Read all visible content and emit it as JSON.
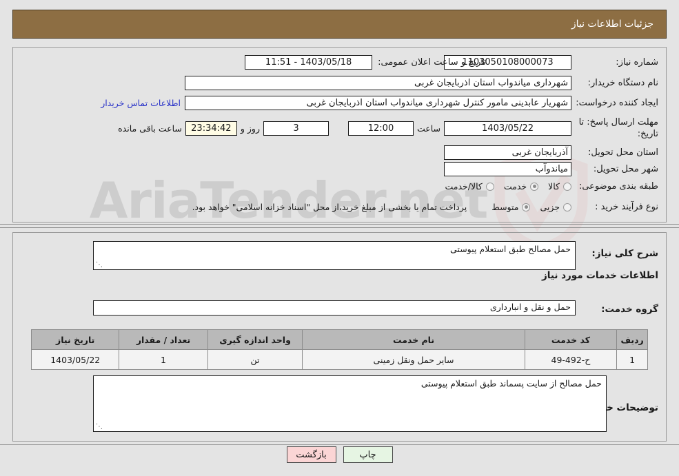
{
  "header": {
    "title": "جزئیات اطلاعات نیاز"
  },
  "watermark": {
    "text": "AriaTender.net",
    "logo": "shield-logo"
  },
  "form": {
    "need_number": {
      "label": "شماره نیاز:",
      "value": "1103050108000073"
    },
    "announce_datetime": {
      "label": "تاریخ و ساعت اعلان عمومی:",
      "value": "1403/05/18 - 11:51"
    },
    "buyer_org": {
      "label": "نام دستگاه خریدار:",
      "value": "شهرداری میاندواب استان اذربایجان غربی"
    },
    "requester": {
      "label": "ایجاد کننده درخواست:",
      "value": "شهریار  عابدینی مامور کنترل شهرداری میاندواب استان اذربایجان غربی",
      "contact_link": "اطلاعات تماس خریدار"
    },
    "deadline": {
      "label": "مهلت ارسال پاسخ: تا تاریخ:",
      "date": "1403/05/22",
      "time_label": "ساعت",
      "time": "12:00",
      "days": "3",
      "days_suffix": "روز و",
      "countdown": "23:34:42",
      "countdown_suffix": "ساعت باقی مانده"
    },
    "delivery_province": {
      "label": "استان محل تحویل:",
      "value": "آذربایجان غربی"
    },
    "delivery_city": {
      "label": "شهر محل تحویل:",
      "value": "میاندوآب"
    },
    "category": {
      "label": "طبقه بندی موضوعی:",
      "options": [
        {
          "label": "کالا",
          "selected": false
        },
        {
          "label": "خدمت",
          "selected": true
        },
        {
          "label": "کالا/خدمت",
          "selected": false
        }
      ]
    },
    "purchase_type": {
      "label": "نوع فرآیند خرید :",
      "options": [
        {
          "label": "جزیی",
          "selected": false
        },
        {
          "label": "متوسط",
          "selected": true
        }
      ],
      "note": "پرداخت تمام یا بخشی از مبلغ خرید،از محل \"اسناد خزانه اسلامی\" خواهد بود."
    }
  },
  "general_description": {
    "label": "شرح کلی نیاز:",
    "value": "حمل مصالح طبق استعلام پیوستی"
  },
  "services_section": {
    "heading": "اطلاعات خدمات مورد نیاز",
    "service_group": {
      "label": "گروه خدمت:",
      "value": "حمل و نقل و انبارداری"
    }
  },
  "table": {
    "columns": [
      "ردیف",
      "کد خدمت",
      "نام خدمت",
      "واحد اندازه گیری",
      "تعداد / مقدار",
      "تاریخ نیاز"
    ],
    "rows": [
      {
        "index": "1",
        "service_code": "ح-492-49",
        "service_name": "سایر حمل ونقل زمینی",
        "unit": "تن",
        "quantity": "1",
        "need_date": "1403/05/22"
      }
    ]
  },
  "buyer_notes": {
    "label": "توضیحات خریدار:",
    "value": "حمل مصالح از سایت پسماند طبق استعلام پیوستی"
  },
  "buttons": {
    "back": "بازگشت",
    "print": "چاپ"
  }
}
